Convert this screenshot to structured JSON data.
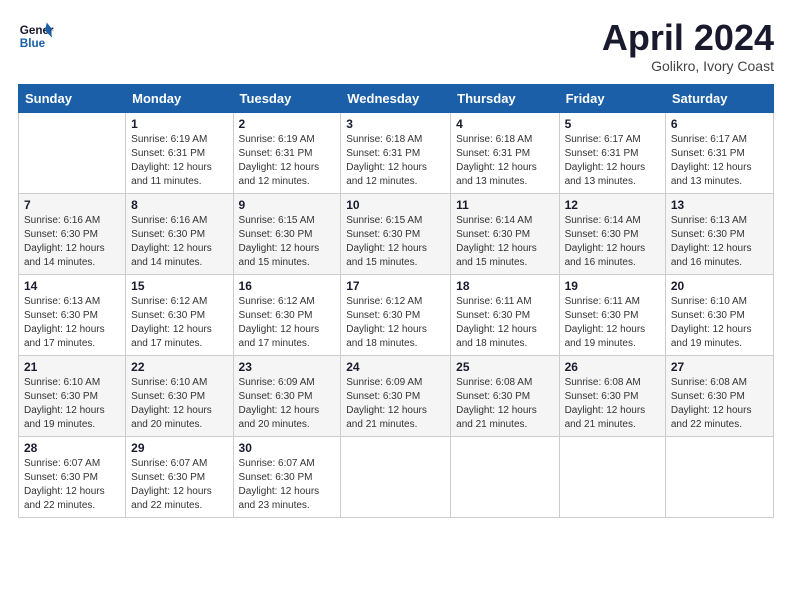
{
  "header": {
    "logo_line1": "General",
    "logo_line2": "Blue",
    "month_title": "April 2024",
    "location": "Golikro, Ivory Coast"
  },
  "weekdays": [
    "Sunday",
    "Monday",
    "Tuesday",
    "Wednesday",
    "Thursday",
    "Friday",
    "Saturday"
  ],
  "weeks": [
    [
      {
        "day": "",
        "info": ""
      },
      {
        "day": "1",
        "info": "Sunrise: 6:19 AM\nSunset: 6:31 PM\nDaylight: 12 hours\nand 11 minutes."
      },
      {
        "day": "2",
        "info": "Sunrise: 6:19 AM\nSunset: 6:31 PM\nDaylight: 12 hours\nand 12 minutes."
      },
      {
        "day": "3",
        "info": "Sunrise: 6:18 AM\nSunset: 6:31 PM\nDaylight: 12 hours\nand 12 minutes."
      },
      {
        "day": "4",
        "info": "Sunrise: 6:18 AM\nSunset: 6:31 PM\nDaylight: 12 hours\nand 13 minutes."
      },
      {
        "day": "5",
        "info": "Sunrise: 6:17 AM\nSunset: 6:31 PM\nDaylight: 12 hours\nand 13 minutes."
      },
      {
        "day": "6",
        "info": "Sunrise: 6:17 AM\nSunset: 6:31 PM\nDaylight: 12 hours\nand 13 minutes."
      }
    ],
    [
      {
        "day": "7",
        "info": "Sunrise: 6:16 AM\nSunset: 6:30 PM\nDaylight: 12 hours\nand 14 minutes."
      },
      {
        "day": "8",
        "info": "Sunrise: 6:16 AM\nSunset: 6:30 PM\nDaylight: 12 hours\nand 14 minutes."
      },
      {
        "day": "9",
        "info": "Sunrise: 6:15 AM\nSunset: 6:30 PM\nDaylight: 12 hours\nand 15 minutes."
      },
      {
        "day": "10",
        "info": "Sunrise: 6:15 AM\nSunset: 6:30 PM\nDaylight: 12 hours\nand 15 minutes."
      },
      {
        "day": "11",
        "info": "Sunrise: 6:14 AM\nSunset: 6:30 PM\nDaylight: 12 hours\nand 15 minutes."
      },
      {
        "day": "12",
        "info": "Sunrise: 6:14 AM\nSunset: 6:30 PM\nDaylight: 12 hours\nand 16 minutes."
      },
      {
        "day": "13",
        "info": "Sunrise: 6:13 AM\nSunset: 6:30 PM\nDaylight: 12 hours\nand 16 minutes."
      }
    ],
    [
      {
        "day": "14",
        "info": "Sunrise: 6:13 AM\nSunset: 6:30 PM\nDaylight: 12 hours\nand 17 minutes."
      },
      {
        "day": "15",
        "info": "Sunrise: 6:12 AM\nSunset: 6:30 PM\nDaylight: 12 hours\nand 17 minutes."
      },
      {
        "day": "16",
        "info": "Sunrise: 6:12 AM\nSunset: 6:30 PM\nDaylight: 12 hours\nand 17 minutes."
      },
      {
        "day": "17",
        "info": "Sunrise: 6:12 AM\nSunset: 6:30 PM\nDaylight: 12 hours\nand 18 minutes."
      },
      {
        "day": "18",
        "info": "Sunrise: 6:11 AM\nSunset: 6:30 PM\nDaylight: 12 hours\nand 18 minutes."
      },
      {
        "day": "19",
        "info": "Sunrise: 6:11 AM\nSunset: 6:30 PM\nDaylight: 12 hours\nand 19 minutes."
      },
      {
        "day": "20",
        "info": "Sunrise: 6:10 AM\nSunset: 6:30 PM\nDaylight: 12 hours\nand 19 minutes."
      }
    ],
    [
      {
        "day": "21",
        "info": "Sunrise: 6:10 AM\nSunset: 6:30 PM\nDaylight: 12 hours\nand 19 minutes."
      },
      {
        "day": "22",
        "info": "Sunrise: 6:10 AM\nSunset: 6:30 PM\nDaylight: 12 hours\nand 20 minutes."
      },
      {
        "day": "23",
        "info": "Sunrise: 6:09 AM\nSunset: 6:30 PM\nDaylight: 12 hours\nand 20 minutes."
      },
      {
        "day": "24",
        "info": "Sunrise: 6:09 AM\nSunset: 6:30 PM\nDaylight: 12 hours\nand 21 minutes."
      },
      {
        "day": "25",
        "info": "Sunrise: 6:08 AM\nSunset: 6:30 PM\nDaylight: 12 hours\nand 21 minutes."
      },
      {
        "day": "26",
        "info": "Sunrise: 6:08 AM\nSunset: 6:30 PM\nDaylight: 12 hours\nand 21 minutes."
      },
      {
        "day": "27",
        "info": "Sunrise: 6:08 AM\nSunset: 6:30 PM\nDaylight: 12 hours\nand 22 minutes."
      }
    ],
    [
      {
        "day": "28",
        "info": "Sunrise: 6:07 AM\nSunset: 6:30 PM\nDaylight: 12 hours\nand 22 minutes."
      },
      {
        "day": "29",
        "info": "Sunrise: 6:07 AM\nSunset: 6:30 PM\nDaylight: 12 hours\nand 22 minutes."
      },
      {
        "day": "30",
        "info": "Sunrise: 6:07 AM\nSunset: 6:30 PM\nDaylight: 12 hours\nand 23 minutes."
      },
      {
        "day": "",
        "info": ""
      },
      {
        "day": "",
        "info": ""
      },
      {
        "day": "",
        "info": ""
      },
      {
        "day": "",
        "info": ""
      }
    ]
  ]
}
